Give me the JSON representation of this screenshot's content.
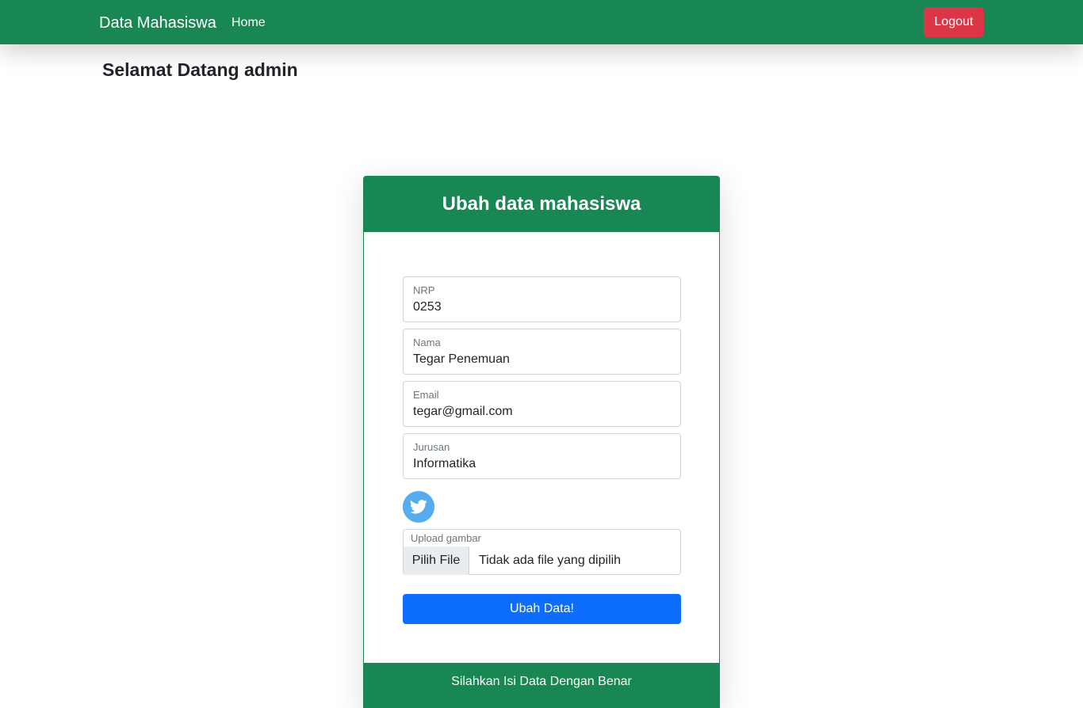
{
  "navbar": {
    "brand": "Data Mahasiswa",
    "home_label": "Home",
    "logout_label": "Logout"
  },
  "welcome": "Selamat Datang admin",
  "card": {
    "title": "Ubah data mahasiswa",
    "fields": [
      {
        "label": "NRP",
        "value": "0253"
      },
      {
        "label": "Nama",
        "value": "Tegar Penemuan"
      },
      {
        "label": "Email",
        "value": "tegar@gmail.com"
      },
      {
        "label": "Jurusan",
        "value": "Informatika"
      }
    ],
    "social_icon": "twitter-icon",
    "upload": {
      "label": "Upload gambar",
      "button": "Pilih File",
      "status": "Tidak ada file yang dipilih"
    },
    "submit_label": "Ubah Data!",
    "footer": "Silahkan Isi Data Dengan Benar"
  },
  "colors": {
    "navbar": "#198754",
    "logout": "#dc3545",
    "submit": "#0d6efd",
    "twitter": "#55acee"
  }
}
